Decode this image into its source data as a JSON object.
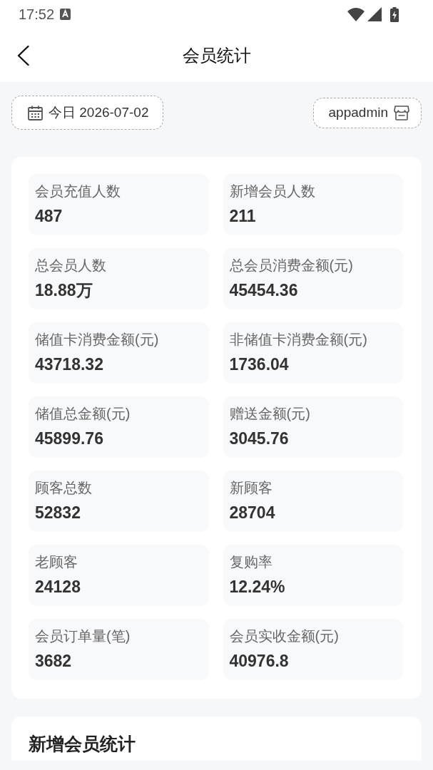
{
  "status_bar": {
    "time": "17:52"
  },
  "header": {
    "title": "会员统计"
  },
  "filters": {
    "date": {
      "label": "今日 2026-07-02"
    },
    "account": {
      "label": "appadmin"
    }
  },
  "stats": [
    {
      "label": "会员充值人数",
      "value": "487"
    },
    {
      "label": "新增会员人数",
      "value": "211"
    },
    {
      "label": "总会员人数",
      "value": "18.88万"
    },
    {
      "label": "总会员消费金额(元)",
      "value": "45454.36"
    },
    {
      "label": "储值卡消费金额(元)",
      "value": "43718.32"
    },
    {
      "label": "非储值卡消费金额(元)",
      "value": "1736.04"
    },
    {
      "label": "储值总金额(元)",
      "value": "45899.76"
    },
    {
      "label": "赠送金额(元)",
      "value": "3045.76"
    },
    {
      "label": "顾客总数",
      "value": "52832"
    },
    {
      "label": "新顾客",
      "value": "28704"
    },
    {
      "label": "老顾客",
      "value": "24128"
    },
    {
      "label": "复购率",
      "value": "12.24%"
    },
    {
      "label": "会员订单量(笔)",
      "value": "3682"
    },
    {
      "label": "会员实收金额(元)",
      "value": "40976.8"
    }
  ],
  "sections": [
    {
      "title": "新增会员统计"
    }
  ]
}
